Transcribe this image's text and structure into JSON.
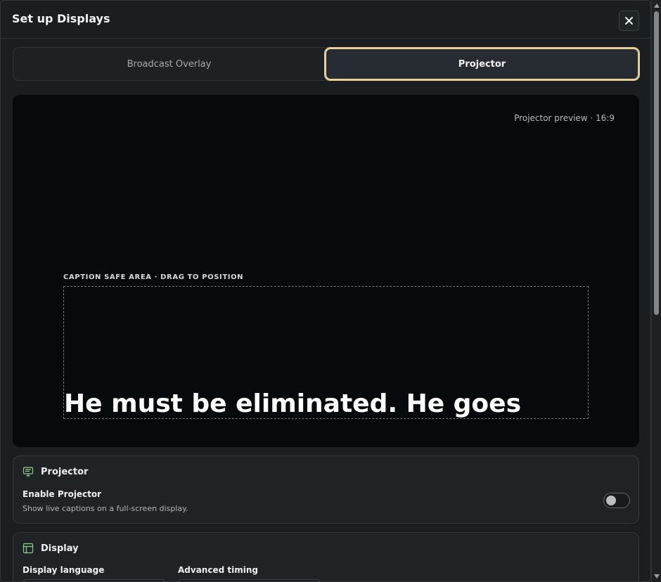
{
  "dialog": {
    "title": "Set up Displays",
    "close_icon": "close-icon"
  },
  "tabs": [
    {
      "label": "Broadcast Overlay",
      "selected": false
    },
    {
      "label": "Projector",
      "selected": true
    }
  ],
  "preview": {
    "label": "Projector preview · 16:9",
    "safe_area_label": "CAPTION SAFE AREA · DRAG TO POSITION",
    "caption_text": "He must be eliminated. He goes"
  },
  "projector_card": {
    "icon": "projector-icon",
    "title": "Projector",
    "enable_label": "Enable Projector",
    "enable_help": "Show live captions on a full-screen display.",
    "enabled": false
  },
  "display_card": {
    "icon": "layout-icon",
    "title": "Display",
    "display_language_label": "Display language",
    "advanced_timing_label": "Advanced timing"
  },
  "colors": {
    "accent": "#e6cf98",
    "background": "#1a1e21",
    "preview_background": "#070a0c"
  }
}
